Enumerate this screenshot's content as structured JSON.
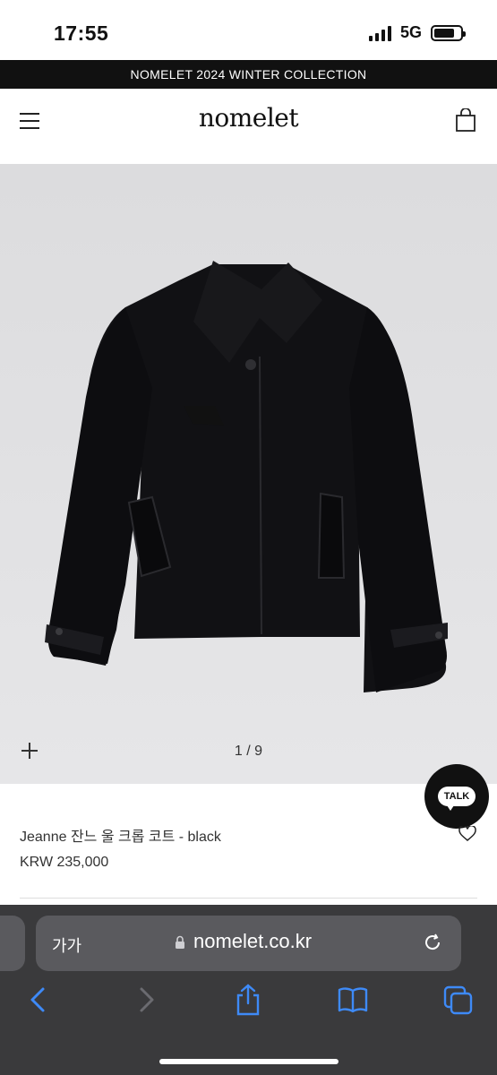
{
  "status_bar": {
    "time": "17:55",
    "network": "5G",
    "signal_bars": 4,
    "battery_level": 0.8
  },
  "promo": {
    "text": "NOMELET 2024 WINTER COLLECTION"
  },
  "header": {
    "logo": "nomelet",
    "menu_icon": "hamburger-menu-icon",
    "cart_icon": "shopping-bag-icon"
  },
  "gallery": {
    "counter": "1 / 9",
    "plus_icon": "plus-icon",
    "background_color": "#e1e1e3"
  },
  "chat": {
    "label": "TALK"
  },
  "product": {
    "name": "Jeanne 잔느 울 크롭 코트 - black",
    "price": "KRW 235,000",
    "wishlist_icon": "heart-icon"
  },
  "browser": {
    "text_size_label": "가가",
    "url": "nomelet.co.kr",
    "lock_icon": "lock-icon",
    "reload_icon": "reload-icon",
    "toolbar_icons": [
      "back-icon",
      "forward-icon",
      "share-icon",
      "bookmarks-icon",
      "tabs-icon"
    ],
    "accent_color": "#3e8af7"
  }
}
